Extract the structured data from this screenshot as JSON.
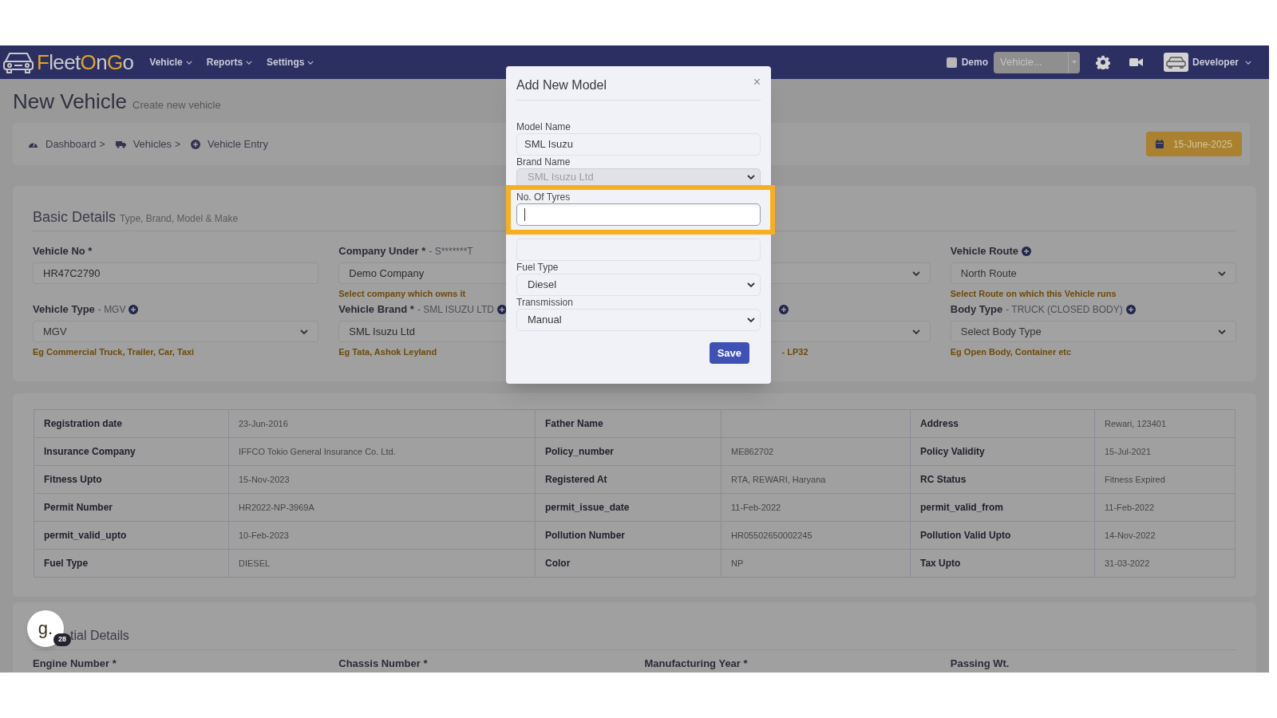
{
  "navbar": {
    "logo": [
      {
        "text": "F",
        "accent": true
      },
      {
        "text": "leet",
        "accent": false
      },
      {
        "text": "O",
        "accent": true
      },
      {
        "text": "n",
        "accent": false
      },
      {
        "text": "G",
        "accent": true
      },
      {
        "text": "o",
        "accent": false
      }
    ],
    "menus": [
      "Vehicle",
      "Reports",
      "Settings"
    ],
    "demo": {
      "label": "Demo",
      "checked": false
    },
    "vehicle_select": {
      "value": "Vehicle..."
    },
    "user": "Developer"
  },
  "page": {
    "title": "New Vehicle",
    "subtitle": "Create new vehicle"
  },
  "breadcrumb": [
    {
      "label": "Dashboard",
      "separator": ">"
    },
    {
      "label": "Vehicles",
      "separator": ">"
    },
    {
      "label": "Vehicle Entry"
    }
  ],
  "date_button": "15-June-2025",
  "basic_details": {
    "title": "Basic Details",
    "subtitle": "Type, Brand, Model & Make",
    "rows": [
      [
        {
          "kind": "input",
          "label": "Vehicle No *",
          "value": "HR47C2790",
          "add": false
        },
        {
          "kind": "input",
          "label": "Company Under *",
          "detail": "- S*******T",
          "value": "Demo Company",
          "hint": "Select company which owns it",
          "add": false
        },
        {
          "kind": "select",
          "add": false
        },
        {
          "kind": "select",
          "label": "Vehicle Route",
          "add": true,
          "value": "North Route",
          "hint": "Select Route on which this Vehicle runs"
        }
      ],
      [
        {
          "kind": "select",
          "label": "Vehicle Type",
          "detail": "- MGV",
          "add": true,
          "value": "MGV",
          "hint": "Eg Commercial Truck, Trailer, Car, Taxi"
        },
        {
          "kind": "input",
          "label": "Vehicle Brand *",
          "detail": "- SML ISUZU LTD",
          "add": true,
          "value": "SML Isuzu Ltd",
          "hint": "Eg Tata, Ashok Leyland"
        },
        {
          "kind": "select",
          "add": true,
          "hint": "- LP32"
        },
        {
          "kind": "select",
          "label": "Body Type",
          "detail": "- TRUCK (CLOSED BODY)",
          "add": true,
          "value": "Select Body Type",
          "hint": "Eg Open Body, Container etc"
        }
      ]
    ]
  },
  "details_table": {
    "rows": [
      [
        {
          "label": "Registration date",
          "value": "23-Jun-2016"
        },
        {
          "label": "Father Name"
        },
        {
          "label": "Address",
          "value": "Rewari, 123401"
        }
      ],
      [
        {
          "label": "Insurance Company",
          "value": "IFFCO Tokio General Insurance Co. Ltd."
        },
        {
          "label": "Policy_number",
          "value": "ME862702"
        },
        {
          "label": "Policy Validity",
          "value": "15-Jul-2021"
        }
      ],
      [
        {
          "label": "Fitness Upto",
          "value": "15-Nov-2023"
        },
        {
          "label": "Registered At",
          "value": "RTA, REWARI, Haryana"
        },
        {
          "label": "RC Status",
          "value": "Fitness Expired"
        }
      ],
      [
        {
          "label": "Permit Number",
          "value": "HR2022-NP-3969A"
        },
        {
          "label": "permit_issue_date",
          "value": "11-Feb-2022"
        },
        {
          "label": "permit_valid_from",
          "value": "11-Feb-2022"
        }
      ],
      [
        {
          "label": "permit_valid_upto",
          "value": "10-Feb-2023"
        },
        {
          "label": "Pollution Number",
          "value": "HR05502650002245"
        },
        {
          "label": "Pollution Valid Upto",
          "value": "14-Nov-2022"
        }
      ],
      [
        {
          "label": "Fuel Type",
          "value": "DIESEL"
        },
        {
          "label": "Color",
          "value": "NP"
        },
        {
          "label": "Tax Upto",
          "value": "31-03-2022"
        }
      ]
    ]
  },
  "more_details": {
    "title": "tial Details",
    "fields": [
      "Engine Number *",
      "Chassis Number *",
      "Manufacturing Year *",
      "Passing Wt."
    ]
  },
  "help_widget": {
    "letter": "g.",
    "count": "28"
  },
  "modal": {
    "title": "Add New Model",
    "close": "×",
    "save": "Save",
    "fields": [
      {
        "kind": "input",
        "label": "Model Name",
        "value": "SML Isuzu",
        "disabled": false,
        "focused": false,
        "highlighted": false
      },
      {
        "kind": "select",
        "label": "Brand Name",
        "value": "SML Isuzu Ltd",
        "disabled": true,
        "focused": false,
        "highlighted": false
      },
      {
        "kind": "input",
        "label": "No. Of Tyres",
        "disabled": false,
        "focused": true,
        "highlighted": true
      },
      {
        "kind": "input",
        "disabled": false,
        "focused": false,
        "highlighted": false
      },
      {
        "kind": "select",
        "label": "Fuel Type",
        "value": "Diesel",
        "disabled": false,
        "focused": false,
        "highlighted": false
      },
      {
        "kind": "select",
        "label": "Transmission",
        "value": "Manual",
        "disabled": false,
        "focused": false,
        "highlighted": false
      }
    ]
  }
}
